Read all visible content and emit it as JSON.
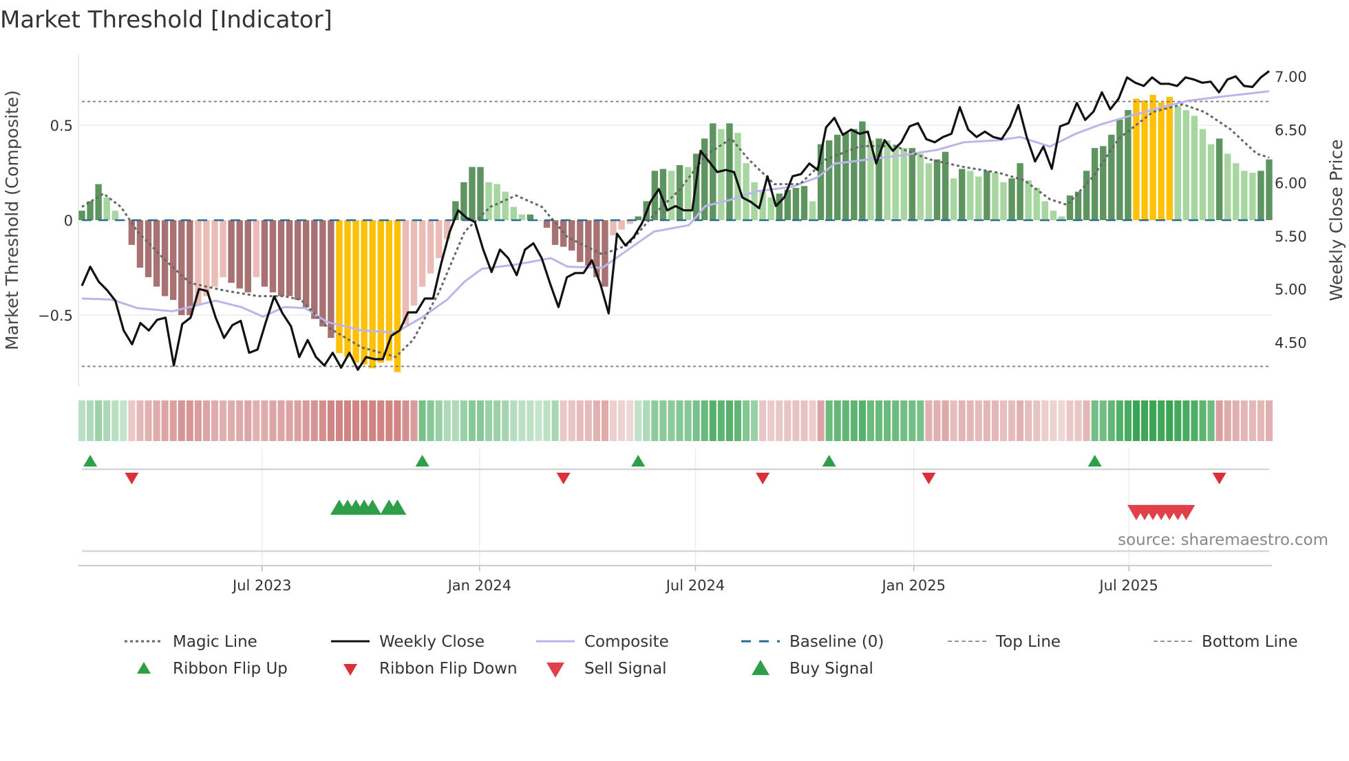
{
  "chart_data": {
    "type": "bar",
    "title": "Market Threshold [Indicator]",
    "ylabel": "Market Threshold (Composite)",
    "y2label": "Weekly Close Price",
    "ylim": [
      -0.88,
      0.88
    ],
    "y2lim": [
      4.2,
      7.1
    ],
    "yticks": [
      {
        "v": 0.5,
        "label": "0.5"
      },
      {
        "v": 0,
        "label": "0"
      },
      {
        "v": -0.5,
        "label": "−0.5"
      }
    ],
    "y2ticks": [
      {
        "v": 7.0,
        "label": "7.00"
      },
      {
        "v": 6.5,
        "label": "6.50"
      },
      {
        "v": 6.0,
        "label": "6.00"
      },
      {
        "v": 5.5,
        "label": "5.50"
      },
      {
        "v": 5.0,
        "label": "5.00"
      },
      {
        "v": 4.5,
        "label": "4.50"
      }
    ],
    "xticks": [
      {
        "week": 21.7,
        "label": "Jul 2023"
      },
      {
        "week": 47.9,
        "label": "Jan 2024"
      },
      {
        "week": 73.9,
        "label": "Jul 2024"
      },
      {
        "week": 100.2,
        "label": "Jan 2025"
      },
      {
        "week": 126.1,
        "label": "Jul 2025"
      }
    ],
    "weeks": 144,
    "top_line": 0.625,
    "bottom_line": -0.77,
    "baseline": 0,
    "composite_bars": [
      0.05,
      0.1,
      0.19,
      0.12,
      0.05,
      0.0,
      -0.13,
      -0.25,
      -0.3,
      -0.35,
      -0.4,
      -0.42,
      -0.5,
      -0.5,
      -0.45,
      -0.4,
      -0.35,
      -0.3,
      -0.33,
      -0.36,
      -0.38,
      -0.3,
      -0.35,
      -0.38,
      -0.4,
      -0.4,
      -0.42,
      -0.46,
      -0.52,
      -0.56,
      -0.62,
      -0.7,
      -0.72,
      -0.75,
      -0.76,
      -0.78,
      -0.75,
      -0.74,
      -0.8,
      -0.55,
      -0.45,
      -0.35,
      -0.28,
      -0.2,
      -0.1,
      0.1,
      0.2,
      0.28,
      0.28,
      0.2,
      0.19,
      0.15,
      0.07,
      0.03,
      0.03,
      0.0,
      -0.04,
      -0.13,
      -0.14,
      -0.16,
      -0.22,
      -0.24,
      -0.3,
      -0.35,
      -0.08,
      -0.05,
      -0.02,
      0.02,
      0.1,
      0.26,
      0.27,
      0.26,
      0.29,
      0.28,
      0.35,
      0.43,
      0.51,
      0.48,
      0.51,
      0.46,
      0.3,
      0.2,
      0.15,
      0.12,
      0.14,
      0.16,
      0.17,
      0.18,
      0.1,
      0.4,
      0.42,
      0.45,
      0.46,
      0.48,
      0.52,
      0.42,
      0.43,
      0.42,
      0.4,
      0.38,
      0.38,
      0.35,
      0.3,
      0.32,
      0.36,
      0.22,
      0.27,
      0.26,
      0.23,
      0.26,
      0.25,
      0.2,
      0.22,
      0.3,
      0.21,
      0.17,
      0.1,
      0.05,
      0.02,
      0.13,
      0.15,
      0.26,
      0.38,
      0.39,
      0.45,
      0.53,
      0.58,
      0.64,
      0.63,
      0.66,
      0.62,
      0.65,
      0.6,
      0.58,
      0.55,
      0.48,
      0.4,
      0.43,
      0.35,
      0.3,
      0.26,
      0.25,
      0.26,
      0.32
    ],
    "weekly_close": [
      5.03,
      5.21,
      5.07,
      4.99,
      4.89,
      4.61,
      4.48,
      4.68,
      4.61,
      4.71,
      4.73,
      4.28,
      4.67,
      4.73,
      5.0,
      4.98,
      4.73,
      4.54,
      4.66,
      4.7,
      4.4,
      4.43,
      4.69,
      4.93,
      4.77,
      4.65,
      4.36,
      4.52,
      4.36,
      4.28,
      4.4,
      4.26,
      4.4,
      4.24,
      4.36,
      4.34,
      4.34,
      4.56,
      4.61,
      4.78,
      4.78,
      4.91,
      4.91,
      5.25,
      5.54,
      5.74,
      5.67,
      5.63,
      5.37,
      5.16,
      5.37,
      5.29,
      5.13,
      5.37,
      5.43,
      5.29,
      5.05,
      4.83,
      5.11,
      5.15,
      5.15,
      5.27,
      5.05,
      4.77,
      5.52,
      5.41,
      5.49,
      5.62,
      5.82,
      5.94,
      5.74,
      5.78,
      5.74,
      5.74,
      6.3,
      6.2,
      6.1,
      6.12,
      6.1,
      5.86,
      5.82,
      5.76,
      6.06,
      5.78,
      5.86,
      6.06,
      6.08,
      6.18,
      6.12,
      6.52,
      6.61,
      6.45,
      6.5,
      6.46,
      6.48,
      6.18,
      6.4,
      6.3,
      6.38,
      6.53,
      6.56,
      6.41,
      6.38,
      6.43,
      6.46,
      6.71,
      6.5,
      6.43,
      6.48,
      6.43,
      6.41,
      6.53,
      6.73,
      6.43,
      6.2,
      6.34,
      6.13,
      6.53,
      6.56,
      6.75,
      6.59,
      6.67,
      6.85,
      6.69,
      6.79,
      6.99,
      6.94,
      6.91,
      6.99,
      6.93,
      6.93,
      6.91,
      6.99,
      6.97,
      6.94,
      6.95,
      6.85,
      6.97,
      7.0,
      6.91,
      6.9,
      6.99,
      7.05
    ],
    "composite_line": [
      [
        0,
        4.91
      ],
      [
        3.6,
        4.9
      ],
      [
        6.7,
        4.82
      ],
      [
        10.9,
        4.79
      ],
      [
        14,
        4.85
      ],
      [
        16.1,
        4.89
      ],
      [
        19.2,
        4.83
      ],
      [
        21.8,
        4.74
      ],
      [
        24.4,
        4.83
      ],
      [
        26.9,
        4.82
      ],
      [
        29.5,
        4.69
      ],
      [
        33.7,
        4.61
      ],
      [
        37.8,
        4.59
      ],
      [
        40.9,
        4.73
      ],
      [
        44,
        4.9
      ],
      [
        46.1,
        5.07
      ],
      [
        48.2,
        5.19
      ],
      [
        52.3,
        5.23
      ],
      [
        56.5,
        5.29
      ],
      [
        58.5,
        5.21
      ],
      [
        62.7,
        5.2
      ],
      [
        65.8,
        5.37
      ],
      [
        68.9,
        5.54
      ],
      [
        73.1,
        5.6
      ],
      [
        75.1,
        5.78
      ],
      [
        78.2,
        5.84
      ],
      [
        81.3,
        5.92
      ],
      [
        85.5,
        5.96
      ],
      [
        88.6,
        6.05
      ],
      [
        90.7,
        6.18
      ],
      [
        93.8,
        6.21
      ],
      [
        99,
        6.26
      ],
      [
        103.1,
        6.31
      ],
      [
        106.2,
        6.38
      ],
      [
        110.4,
        6.4
      ],
      [
        113,
        6.43
      ],
      [
        116.6,
        6.34
      ],
      [
        119.7,
        6.46
      ],
      [
        122.8,
        6.55
      ],
      [
        125.9,
        6.62
      ],
      [
        130.1,
        6.71
      ],
      [
        133.2,
        6.77
      ],
      [
        137.3,
        6.81
      ],
      [
        143,
        6.86
      ]
    ],
    "magic_line": [
      [
        0,
        0.07
      ],
      [
        2.6,
        0.14
      ],
      [
        4.7,
        0.07
      ],
      [
        6.7,
        -0.06
      ],
      [
        9.8,
        -0.2
      ],
      [
        13,
        -0.33
      ],
      [
        17.1,
        -0.37
      ],
      [
        21.2,
        -0.4
      ],
      [
        24.4,
        -0.4
      ],
      [
        26.4,
        -0.42
      ],
      [
        29.5,
        -0.56
      ],
      [
        33.7,
        -0.67
      ],
      [
        37.8,
        -0.72
      ],
      [
        39.9,
        -0.63
      ],
      [
        43,
        -0.38
      ],
      [
        46.1,
        -0.06
      ],
      [
        49.2,
        0.07
      ],
      [
        52.3,
        0.13
      ],
      [
        55.4,
        0.07
      ],
      [
        58.5,
        -0.09
      ],
      [
        62.7,
        -0.18
      ],
      [
        65.8,
        -0.13
      ],
      [
        68.9,
        0.03
      ],
      [
        72,
        0.16
      ],
      [
        75.1,
        0.34
      ],
      [
        78.2,
        0.43
      ],
      [
        80.3,
        0.32
      ],
      [
        83.4,
        0.19
      ],
      [
        86.5,
        0.19
      ],
      [
        89.6,
        0.32
      ],
      [
        93.8,
        0.39
      ],
      [
        97.9,
        0.39
      ],
      [
        102.1,
        0.32
      ],
      [
        106.2,
        0.28
      ],
      [
        110.4,
        0.25
      ],
      [
        113.5,
        0.21
      ],
      [
        116.6,
        0.11
      ],
      [
        118.7,
        0.08
      ],
      [
        121.8,
        0.23
      ],
      [
        124.9,
        0.43
      ],
      [
        129,
        0.57
      ],
      [
        132.6,
        0.61
      ],
      [
        135.2,
        0.57
      ],
      [
        138.3,
        0.48
      ],
      [
        141.5,
        0.35
      ],
      [
        143,
        0.33
      ]
    ],
    "ribbon": [
      {
        "from": 0,
        "to": 5,
        "state": "up"
      },
      {
        "from": 6,
        "to": 40,
        "state": "down"
      },
      {
        "from": 41,
        "to": 57,
        "state": "up"
      },
      {
        "from": 58,
        "to": 66,
        "state": "down"
      },
      {
        "from": 67,
        "to": 81,
        "state": "up"
      },
      {
        "from": 82,
        "to": 89,
        "state": "down"
      },
      {
        "from": 90,
        "to": 101,
        "state": "up"
      },
      {
        "from": 102,
        "to": 121,
        "state": "down"
      },
      {
        "from": 122,
        "to": 136,
        "state": "up"
      },
      {
        "from": 137,
        "to": 143,
        "state": "down"
      }
    ],
    "ribbon_flip_up": [
      1,
      41,
      67,
      90,
      122
    ],
    "ribbon_flip_down": [
      6,
      58,
      82,
      102,
      137
    ],
    "buy_signals": [
      31,
      32,
      33,
      34,
      35,
      37,
      38
    ],
    "sell_signals": [
      127,
      128,
      129,
      130,
      131,
      132,
      133
    ],
    "legend": [
      {
        "label": "Magic Line",
        "kind": "dotted",
        "color": "#666666"
      },
      {
        "label": "Weekly Close",
        "kind": "solid",
        "color": "#111111"
      },
      {
        "label": "Composite",
        "kind": "solid",
        "color": "#bdb4ec"
      },
      {
        "label": "Baseline (0)",
        "kind": "dashed",
        "color": "#2b6c94"
      },
      {
        "label": "Top Line",
        "kind": "dashed-thin",
        "color": "#888888"
      },
      {
        "label": "Bottom Line",
        "kind": "dashed-thin",
        "color": "#888888"
      },
      {
        "label": "Ribbon Flip Up",
        "kind": "tri-up",
        "color": "#2e9e48"
      },
      {
        "label": "Ribbon Flip Down",
        "kind": "tri-down",
        "color": "#d9303a"
      },
      {
        "label": "Sell Signal",
        "kind": "tri-down-big",
        "color": "#e0404a"
      },
      {
        "label": "Buy Signal",
        "kind": "tri-up-big",
        "color": "#2e9e48"
      }
    ],
    "colors": {
      "up_strong": "#5e9460",
      "up_weak": "#a8d6a0",
      "down_strong": "#a87272",
      "down_weak": "#ebbcb5",
      "extreme": "#ffc107"
    }
  },
  "source": "source: sharemaestro.com"
}
